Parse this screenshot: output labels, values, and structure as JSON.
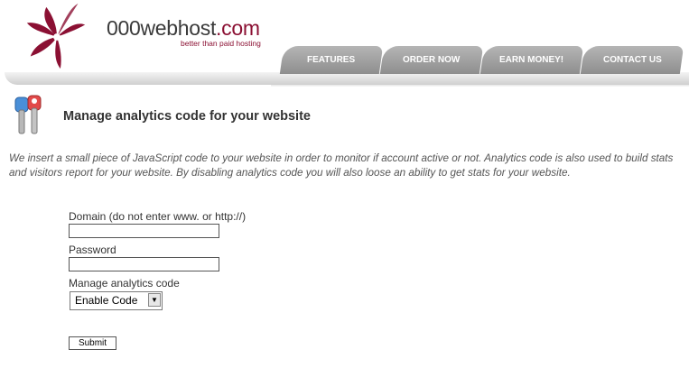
{
  "header": {
    "brand": "000webhost",
    "brand_tld": ".com",
    "tagline": "better than paid hosting",
    "nav": [
      {
        "label": "FEATURES"
      },
      {
        "label": "ORDER NOW"
      },
      {
        "label": "EARN MONEY!"
      },
      {
        "label": "CONTACT US"
      }
    ]
  },
  "main": {
    "title": "Manage analytics code for your website",
    "intro": "We insert a small piece of JavaScript code to your website in order to monitor if account active or not. Analytics code is also used to build stats and visitors report for your website. By disabling analytics code you will also loose an ability to get stats for your website."
  },
  "form": {
    "domain_label": "Domain (do not enter www. or http://)",
    "domain_value": "",
    "password_label": "Password",
    "password_value": "",
    "analytics_label": "Manage analytics code",
    "analytics_selected": "Enable Code",
    "submit_label": "Submit"
  },
  "colors": {
    "brand_accent": "#8b1033",
    "tab_gray": "#9e9e9e",
    "intro_text": "#555555"
  },
  "icons": {
    "logo": "swirl-logo-icon",
    "title": "keys-icon",
    "dropdown": "chevron-down-icon"
  }
}
